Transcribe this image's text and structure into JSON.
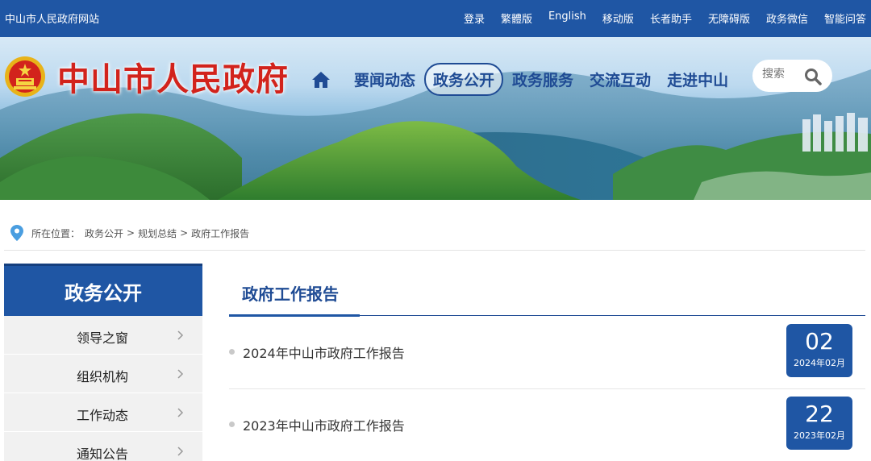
{
  "topbar": {
    "site_name": "中山市人民政府网站",
    "links": [
      "登录",
      "繁體版",
      "English",
      "移动版",
      "长者助手",
      "无障碍版",
      "政务微信",
      "智能问答"
    ]
  },
  "header": {
    "title": "中山市人民政府",
    "nav": [
      "要闻动态",
      "政务公开",
      "政务服务",
      "交流互动",
      "走进中山"
    ],
    "active_nav": "政务公开",
    "search_placeholder": "搜索"
  },
  "breadcrumb": {
    "prefix": "所在位置：",
    "items": [
      "政务公开",
      "规划总结",
      "政府工作报告"
    ],
    "separator": ">"
  },
  "sidebar": {
    "heading": "政务公开",
    "items": [
      {
        "label": "领导之窗"
      },
      {
        "label": "组织机构"
      },
      {
        "label": "工作动态"
      },
      {
        "label": "通知公告"
      }
    ]
  },
  "main": {
    "title": "政府工作报告",
    "rows": [
      {
        "title": "2024年中山市政府工作报告",
        "day": "02",
        "year_month": "2024年02月"
      },
      {
        "title": "2023年中山市政府工作报告",
        "day": "22",
        "year_month": "2023年02月"
      }
    ]
  },
  "colors": {
    "primary": "#1f56a4",
    "nav_text": "#1f4b94",
    "title_red": "#d2231c"
  }
}
